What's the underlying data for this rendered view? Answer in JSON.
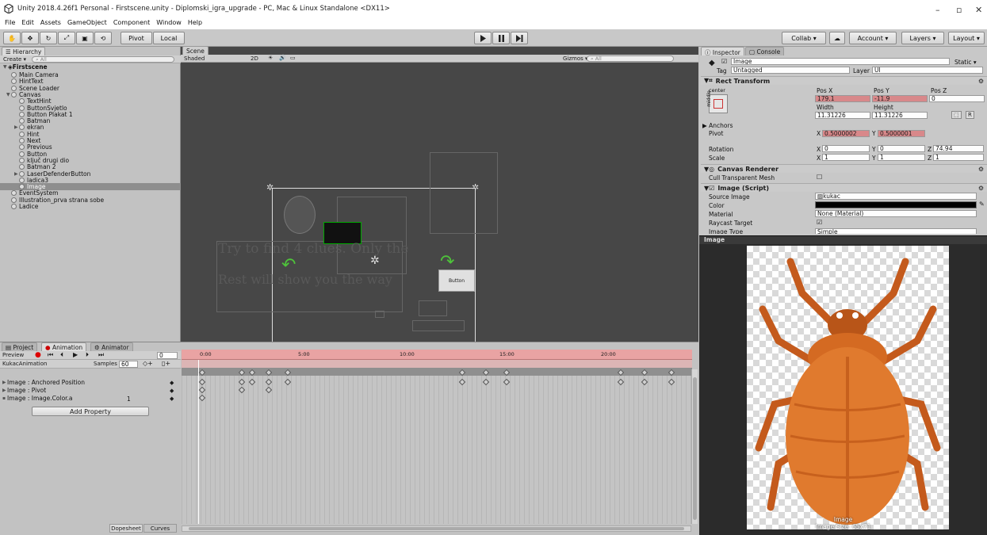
{
  "window": {
    "title": "Unity 2018.4.26f1 Personal - Firstscene.unity - Diplomski_igra_upgrade - PC, Mac & Linux Standalone <DX11>",
    "min": "–",
    "max": "▫",
    "close": "✕"
  },
  "menu": [
    "File",
    "Edit",
    "Assets",
    "GameObject",
    "Component",
    "Window",
    "Help"
  ],
  "toolbar": {
    "pivot": "Pivot",
    "space": "Local",
    "collab": "Collab ▾",
    "account": "Account ▾",
    "layers": "Layers ▾",
    "layout": "Layout ▾"
  },
  "hierarchy": {
    "tab": "Hierarchy",
    "create": "Create ▾",
    "search_placeholder": "All",
    "scene": "Firstscene",
    "items": [
      {
        "name": "Main Camera",
        "indent": 1
      },
      {
        "name": "HintText",
        "indent": 1
      },
      {
        "name": "Scene Loader",
        "indent": 1
      },
      {
        "name": "Canvas",
        "indent": 1,
        "fold": "▼"
      },
      {
        "name": "TextHint",
        "indent": 2
      },
      {
        "name": "ButtonSvjetlo",
        "indent": 2
      },
      {
        "name": "Button Plakat 1",
        "indent": 2
      },
      {
        "name": "Batman",
        "indent": 2
      },
      {
        "name": "ekran",
        "indent": 2,
        "fold": "▶"
      },
      {
        "name": "Hint",
        "indent": 2
      },
      {
        "name": "Next",
        "indent": 2
      },
      {
        "name": "Previous",
        "indent": 2
      },
      {
        "name": "Button",
        "indent": 2
      },
      {
        "name": "ključ drugi dio",
        "indent": 2
      },
      {
        "name": "Batman 2",
        "indent": 2
      },
      {
        "name": "LaserDefenderButton",
        "indent": 2,
        "fold": "▶"
      },
      {
        "name": "ladica3",
        "indent": 2
      },
      {
        "name": "Image",
        "indent": 2,
        "selected": true
      },
      {
        "name": "EventSystem",
        "indent": 1
      },
      {
        "name": "Illustration_prva strana sobe",
        "indent": 1
      },
      {
        "name": "Ladice",
        "indent": 1
      }
    ]
  },
  "scene": {
    "tab": "Scene",
    "shading": "Shaded",
    "mode2d": "2D",
    "gizmos": "Gizmos ▾",
    "search_placeholder": "All",
    "overlay_text_1": "Try to find 4 clues. Only the",
    "overlay_text_2": "Rest will show you the way",
    "btn_label": "Button"
  },
  "animation": {
    "tabs": [
      "Project",
      "Animation",
      "Animator"
    ],
    "preview": "Preview",
    "frame": "0",
    "clip": "KukacAnimation",
    "samples_label": "Samples",
    "samples": "60",
    "timeline_ticks": [
      "0:00",
      "5:00",
      "10:00",
      "15:00",
      "20:00"
    ],
    "properties": [
      {
        "name": "Image : Anchored Position",
        "value": ""
      },
      {
        "name": "Image : Pivot",
        "value": ""
      },
      {
        "name": "Image : Image.Color.a",
        "value": "1"
      }
    ],
    "add_property": "Add Property",
    "dopesheet": "Dopesheet",
    "curves": "Curves"
  },
  "inspector": {
    "tabs": [
      "Inspector",
      "Console"
    ],
    "object_name": "Image",
    "static": "Static ▾",
    "tag_label": "Tag",
    "tag": "Untagged",
    "layer_label": "Layer",
    "layer": "UI",
    "rect_transform": "Rect Transform",
    "anchor_preset": "center",
    "anchor_side": "middle",
    "posx_label": "Pos X",
    "posy_label": "Pos Y",
    "posz_label": "Pos Z",
    "posx": "179.1",
    "posy": "-11.9",
    "posz": "0",
    "width_label": "Width",
    "height_label": "Height",
    "width": "11.31226",
    "height": "11.31226",
    "anchors": "Anchors",
    "pivot_label": "Pivot",
    "pivot_x": "0.5000002",
    "pivot_y": "0.5000001",
    "rotation_label": "Rotation",
    "rot_x": "0",
    "rot_y": "0",
    "rot_z": "74.94",
    "scale_label": "Scale",
    "scale_x": "1",
    "scale_y": "1",
    "scale_z": "1",
    "canvas_renderer": "Canvas Renderer",
    "cull_label": "Cull Transparent Mesh",
    "image_script": "Image (Script)",
    "source_label": "Source Image",
    "source": "kukac",
    "color_label": "Color",
    "material_label": "Material",
    "material": "None (Material)",
    "raycast_label": "Raycast Target",
    "image_type_label": "Image Type",
    "image_type": "Simple"
  },
  "preview": {
    "header": "Image",
    "caption": "Image",
    "size": "Image Size: 65x71"
  }
}
